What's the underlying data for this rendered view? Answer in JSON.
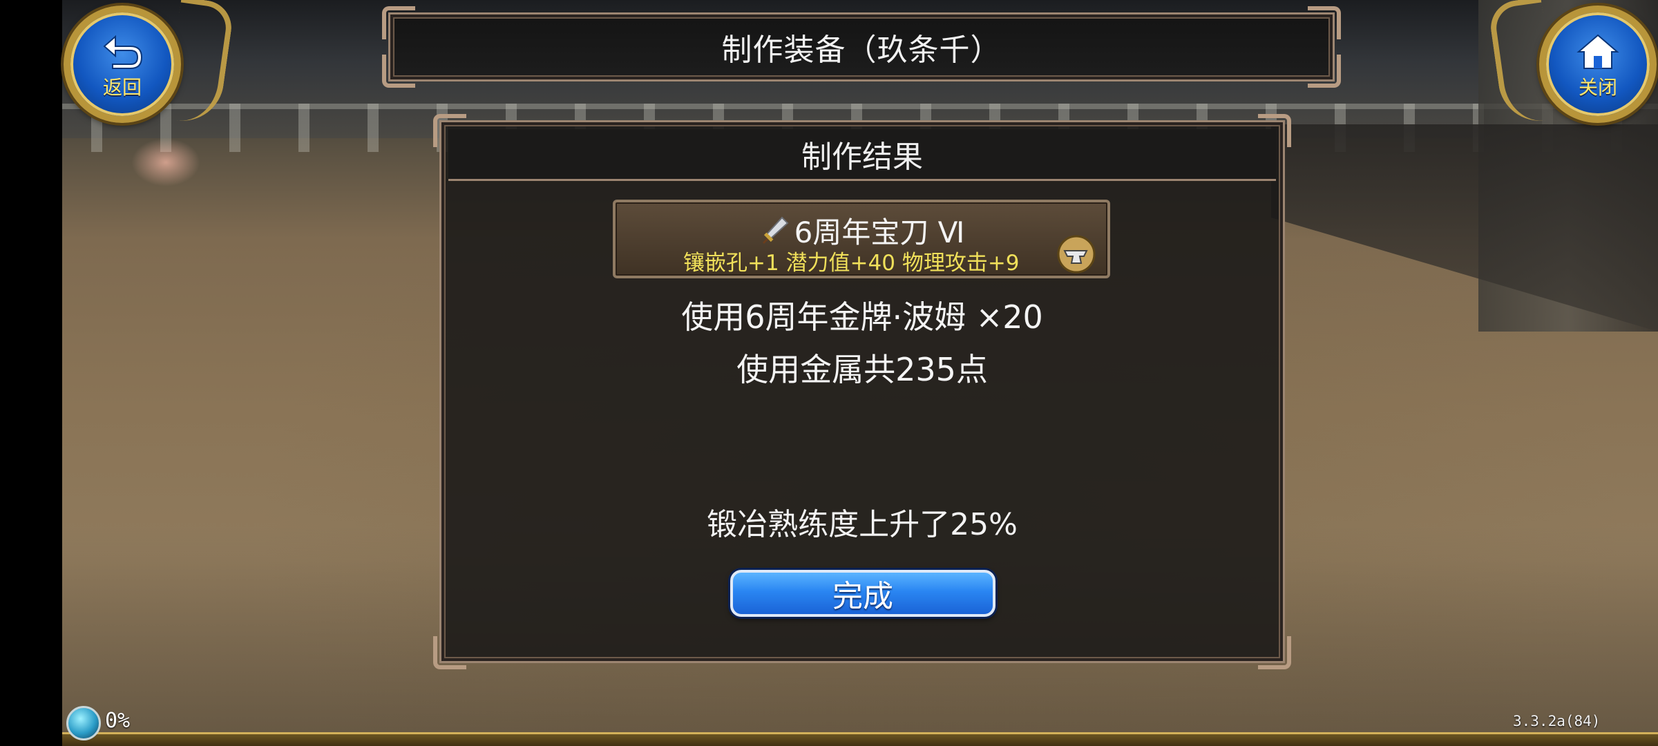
{
  "header": {
    "title": "制作装备（玖条千）",
    "back_label": "返回",
    "close_label": "关闭"
  },
  "panel": {
    "title": "制作结果",
    "item": {
      "name": "6周年宝刀 Ⅵ",
      "stats": "镶嵌孔+1 潜力值+40 物理攻击+9",
      "icon": "sword-icon",
      "badge_icon": "anvil-icon"
    },
    "medal_line": "使用6周年金牌·波姆 ×20",
    "metal_line": "使用金属共235点",
    "skill_line": "锻冶熟练度上升了25%",
    "done_label": "完成"
  },
  "status": {
    "exp_percent": "0%",
    "version": "3.3.2a(84)"
  },
  "colors": {
    "button_blue": "#2a86f2",
    "stat_yellow": "#f0e05a",
    "frame_gold": "#b8953a"
  }
}
